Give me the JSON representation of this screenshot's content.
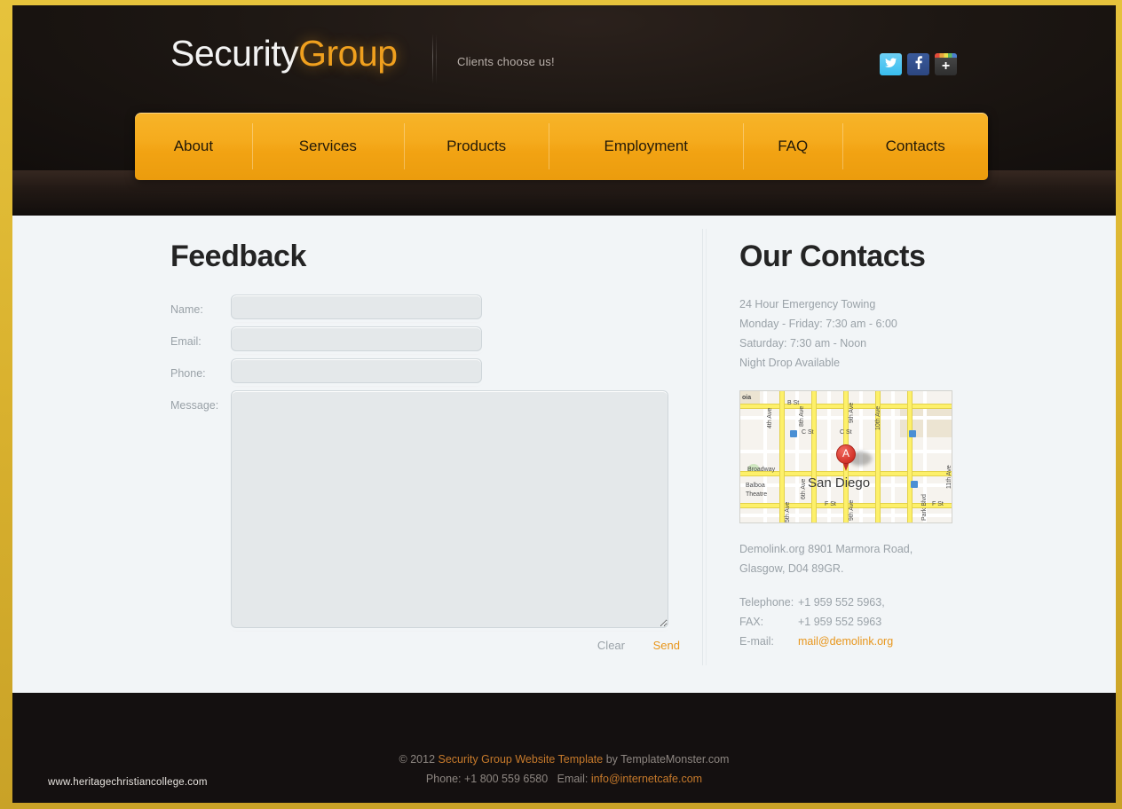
{
  "site": {
    "logo_primary": "Security",
    "logo_accent": "Group",
    "tagline": "Clients choose us!"
  },
  "social": [
    {
      "name": "twitter",
      "glyph": "t",
      "label": "Twitter"
    },
    {
      "name": "facebook",
      "glyph": "f",
      "label": "Facebook"
    },
    {
      "name": "google-plus",
      "glyph": "+",
      "label": "Google Plus"
    }
  ],
  "nav": {
    "items": [
      {
        "label": "About"
      },
      {
        "label": "Services"
      },
      {
        "label": "Products"
      },
      {
        "label": "Employment"
      },
      {
        "label": "FAQ"
      },
      {
        "label": "Contacts"
      }
    ]
  },
  "feedback": {
    "title": "Feedback",
    "fields": [
      {
        "label": "Name:",
        "value": "",
        "placeholder": ""
      },
      {
        "label": "Email:",
        "value": "",
        "placeholder": ""
      },
      {
        "label": "Phone:",
        "value": "",
        "placeholder": ""
      }
    ],
    "message_label": "Message:",
    "message_value": "",
    "message_placeholder": "",
    "clear_label": "Clear",
    "send_label": "Send"
  },
  "contacts": {
    "title": "Our Contacts",
    "hours": [
      "24 Hour Emergency Towing",
      "Monday - Friday: 7:30 am - 6:00",
      "Saturday: 7:30 am - Noon",
      "Night Drop Available"
    ],
    "address": [
      "Demolink.org 8901 Marmora Road,",
      "Glasgow, D04 89GR."
    ],
    "details": [
      {
        "key": "Telephone:",
        "value": "+1 959 552 5963,",
        "link": false
      },
      {
        "key": "FAX:",
        "value": "+1 959 552 5963",
        "link": false
      },
      {
        "key": "E-mail:",
        "value": "mail@demolink.org",
        "link": true
      }
    ],
    "map": {
      "city": "San Diego",
      "marker": "A",
      "labels": [
        "oia",
        "B St",
        "C St",
        "C St",
        "Broadway",
        "Balboa",
        "Theatre",
        "F St",
        "F St",
        "4th Ave",
        "5th Ave",
        "6th Ave",
        "8th Ave",
        "9th Ave",
        "9th Ave",
        "10th Ave",
        "11th Ave",
        "Park Blvd"
      ]
    }
  },
  "footer": {
    "copyright_prefix": "© 2012 ",
    "copyright_link": "Security Group Website Template",
    "copyright_suffix": " by TemplateMonster.com",
    "phone_label": "Phone: +1 800 559 6580",
    "email_label": "Email: ",
    "email_value": "info@internetcafe.com",
    "watermark": "www.heritagechristiancollege.com"
  },
  "colors": {
    "accent_orange": "#f0a01e",
    "nav_orange": "#f5ab1d",
    "link_orange": "#e8961c",
    "frame_gold": "#d9b12e",
    "dark_bg": "#141010",
    "content_bg": "#f2f5f7"
  }
}
